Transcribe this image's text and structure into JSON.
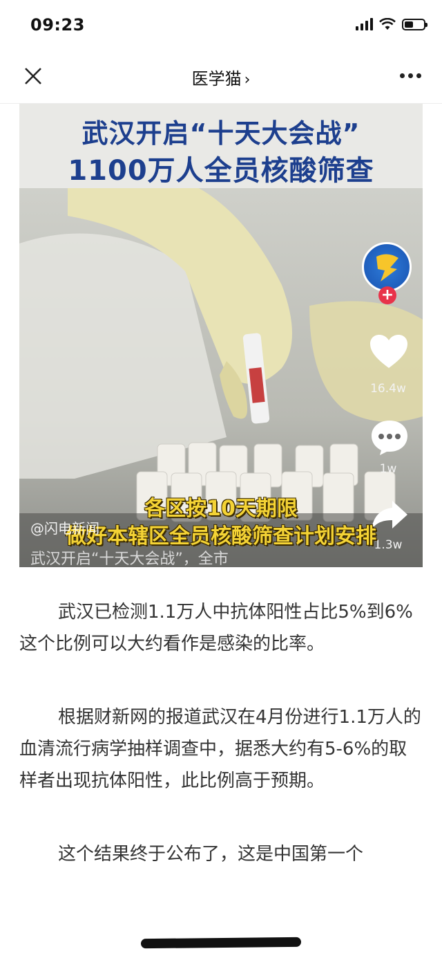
{
  "status_bar": {
    "time": "09:23",
    "battery_level": 0.45,
    "icons": [
      "signal-icon",
      "wifi-icon",
      "battery-icon"
    ]
  },
  "nav": {
    "title": "医学猫",
    "close_icon": "close-icon",
    "chevron_icon": "chevron-right-icon",
    "more_icon": "more-icon"
  },
  "image": {
    "headline_line1": "武汉开启“十天大会战”",
    "headline_line2": "1100万人全员核酸筛查",
    "like_count": "16.4w",
    "comment_count": "1w",
    "share_count": "1.3w",
    "overlay_line1": "各区按10天期限",
    "overlay_line2": "做好本辖区全员核酸筛查计划安排",
    "watermark": "@闪电新闻",
    "caption": "武汉开启“十天大会战”，全市"
  },
  "article": {
    "paragraphs": [
      "武汉已检测1.1万人中抗体阳性占比5%到6%这个比例可以大约看作是感染的比率。",
      "根据财新网的报道武汉在4月份进行1.1万人的血清流行病学抽样调查中，据悉大约有5-6%的取样者出现抗体阳性，此比例高于预期。",
      "这个结果终于公布了，这是中国第一个"
    ]
  }
}
